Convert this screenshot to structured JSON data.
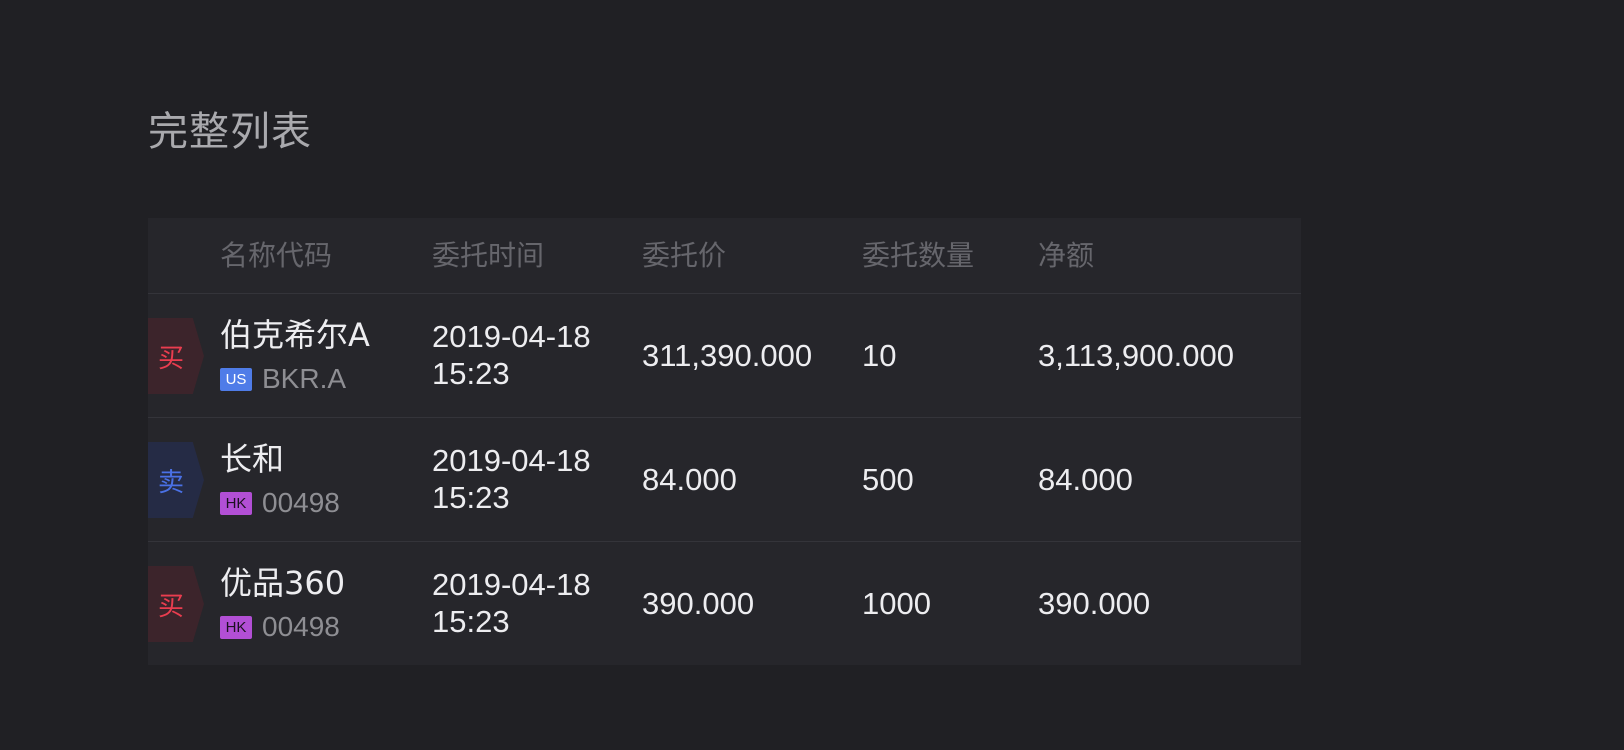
{
  "page": {
    "title": "完整列表"
  },
  "table": {
    "headers": {
      "name": "名称代码",
      "time": "委托时间",
      "price": "委托价",
      "quantity": "委托数量",
      "amount": "净额"
    },
    "rows": [
      {
        "side": "买",
        "side_type": "buy",
        "name": "伯克希尔A",
        "market": "US",
        "code": "BKR.A",
        "date": "2019-04-18",
        "time": "15:23",
        "price": "311,390.000",
        "quantity": "10",
        "amount": "3,113,900.000"
      },
      {
        "side": "卖",
        "side_type": "sell",
        "name": "长和",
        "market": "HK",
        "code": "00498",
        "date": "2019-04-18",
        "time": "15:23",
        "price": "84.000",
        "quantity": "500",
        "amount": "84.000"
      },
      {
        "side": "买",
        "side_type": "buy",
        "name": "优品360",
        "market": "HK",
        "code": "00498",
        "date": "2019-04-18",
        "time": "15:23",
        "price": "390.000",
        "quantity": "1000",
        "amount": "390.000"
      }
    ]
  },
  "colors": {
    "background": "#202024",
    "table_background": "#26262b",
    "buy": "#ea3d4f",
    "sell": "#4a71e6",
    "us_tag": "#4f7ce8",
    "hk_tag": "#b24fd5"
  }
}
